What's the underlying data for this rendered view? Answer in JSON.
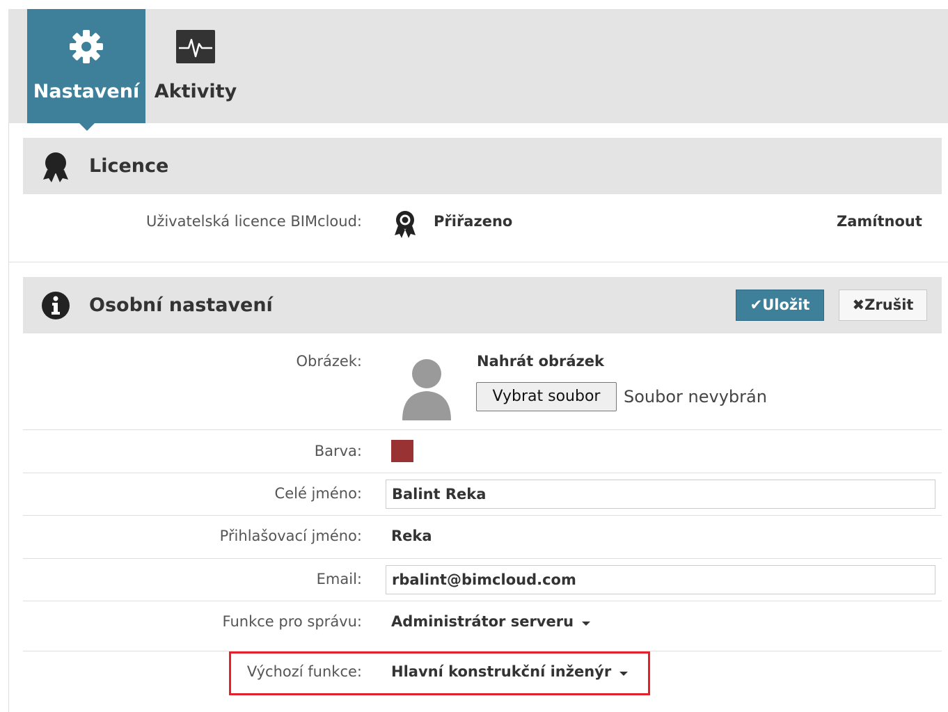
{
  "tabs": [
    {
      "label": "Nastavení",
      "icon": "gear-icon",
      "active": true
    },
    {
      "label": "Aktivity",
      "icon": "activity-icon",
      "active": false
    }
  ],
  "license": {
    "title": "Licence",
    "row_label": "Uživatelská licence BIMcloud:",
    "status": "Přiřazeno",
    "reject_label": "Zamítnout"
  },
  "personal": {
    "title": "Osobní nastavení",
    "save_label": "Uložit",
    "cancel_label": "Zrušit",
    "picture_label": "Obrázek:",
    "upload_title": "Nahrát obrázek",
    "file_button": "Vybrat soubor",
    "file_status": "Soubor nevybrán",
    "color_label": "Barva:",
    "color_value": "#993333",
    "fullname_label": "Celé jméno:",
    "fullname_value": "Balint Reka",
    "login_label": "Přihlašovací jméno:",
    "login_value": "Reka",
    "email_label": "Email:",
    "email_value": "rbalint@bimcloud.com",
    "admin_role_label": "Funkce pro správu:",
    "admin_role_value": "Administrátor serveru",
    "default_role_label": "Výchozí funkce:",
    "default_role_value": "Hlavní konstrukční inženýr"
  },
  "colors": {
    "accent": "#3e7f9a",
    "highlight": "#e3212a",
    "header_bg": "#e4e4e4"
  }
}
